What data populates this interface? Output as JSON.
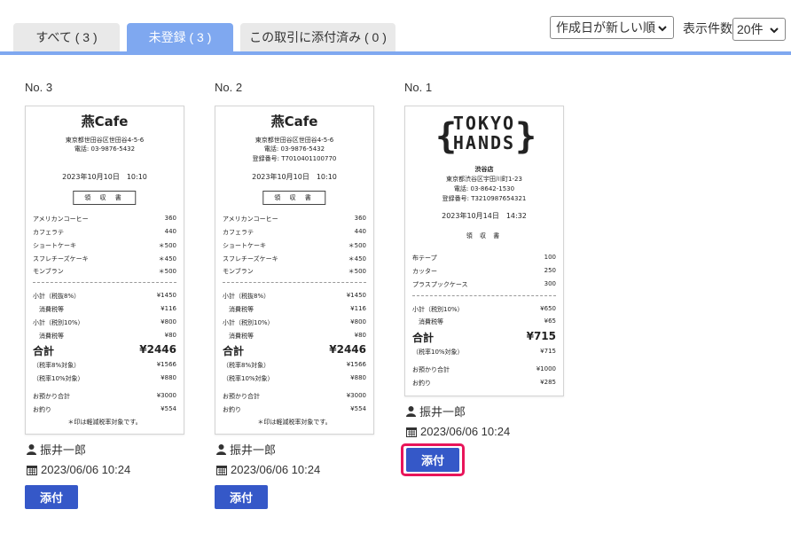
{
  "tabs": [
    {
      "label": "すべて ( 3 )",
      "active": false
    },
    {
      "label": "未登録 ( 3 )",
      "active": true
    },
    {
      "label": "この取引に添付済み ( 0 )",
      "active": false
    }
  ],
  "controls": {
    "sort_value": "作成日が新しい順",
    "count_label": "表示件数",
    "count_value": "20件"
  },
  "cards": [
    {
      "no": "No. 3",
      "uploader": "振井一郎",
      "date": "2023/06/06 10:24",
      "attach_label": "添付",
      "receipt": {
        "store": "燕Cafe",
        "address": "東京都世田谷区世田谷4-5-6",
        "tel": "電話: 03-9876-5432",
        "datetime": "2023年10月10日　10:10",
        "doc": "領 収 書",
        "items": [
          [
            "アメリカンコーヒー",
            "360"
          ],
          [
            "カフェラテ",
            "440"
          ],
          [
            "ショートケーキ",
            "＊500"
          ],
          [
            "スフレチーズケーキ",
            "＊450"
          ],
          [
            "モンブラン",
            "＊500"
          ]
        ],
        "subtotals": [
          [
            "小計（税抜8%）",
            "¥1450"
          ],
          [
            "消費税等",
            "¥116"
          ],
          [
            "小計（税別10%）",
            "¥800"
          ],
          [
            "消費税等",
            "¥80"
          ]
        ],
        "total_label": "合計",
        "total": "¥2446",
        "tax_lines": [
          [
            "（税率8%対象）",
            "¥1566"
          ],
          [
            "（税率10%対象）",
            "¥880"
          ]
        ],
        "pay_lines": [
          [
            "お預かり合計",
            "¥3000"
          ],
          [
            "お釣り",
            "¥554"
          ]
        ],
        "note": "＊印は軽減税率対象です。"
      }
    },
    {
      "no": "No. 2",
      "uploader": "振井一郎",
      "date": "2023/06/06 10:24",
      "attach_label": "添付",
      "receipt": {
        "store": "燕Cafe",
        "address": "東京都世田谷区世田谷4-5-6",
        "tel": "電話: 03-9876-5432",
        "reg": "登録番号: T7010401100770",
        "datetime": "2023年10月10日　10:10",
        "doc": "領 収 書",
        "items": [
          [
            "アメリカンコーヒー",
            "360"
          ],
          [
            "カフェラテ",
            "440"
          ],
          [
            "ショートケーキ",
            "＊500"
          ],
          [
            "スフレチーズケーキ",
            "＊450"
          ],
          [
            "モンブラン",
            "＊500"
          ]
        ],
        "subtotals": [
          [
            "小計（税抜8%）",
            "¥1450"
          ],
          [
            "消費税等",
            "¥116"
          ],
          [
            "小計（税別10%）",
            "¥800"
          ],
          [
            "消費税等",
            "¥80"
          ]
        ],
        "total_label": "合計",
        "total": "¥2446",
        "tax_lines": [
          [
            "（税率8%対象）",
            "¥1566"
          ],
          [
            "（税率10%対象）",
            "¥880"
          ]
        ],
        "pay_lines": [
          [
            "お預かり合計",
            "¥3000"
          ],
          [
            "お釣り",
            "¥554"
          ]
        ],
        "note": "＊印は軽減税率対象です。"
      }
    },
    {
      "no": "No. 1",
      "uploader": "振井一郎",
      "date": "2023/06/06 10:24",
      "attach_label": "添付",
      "receipt": {
        "logo_line1": "TOKYO",
        "logo_line2": "HANDS",
        "branch": "渋谷店",
        "address": "東京都渋谷区宇田川町1-23",
        "tel": "電話: 03-8642-1530",
        "reg": "登録番号: T3210987654321",
        "datetime": "2023年10月14日　14:32",
        "doc": "領 収 書",
        "items": [
          [
            "布テープ",
            "100"
          ],
          [
            "カッター",
            "250"
          ],
          [
            "プラスプックケース",
            "300"
          ]
        ],
        "subtotals": [
          [
            "小計（税別10%）",
            "¥650"
          ],
          [
            "消費税等",
            "¥65"
          ]
        ],
        "total_label": "合計",
        "total": "¥715",
        "tax_lines": [
          [
            "（税率10%対象）",
            "¥715"
          ]
        ],
        "pay_lines": [
          [
            "お預かり合計",
            "¥1000"
          ],
          [
            "お釣り",
            "¥285"
          ]
        ]
      }
    }
  ]
}
